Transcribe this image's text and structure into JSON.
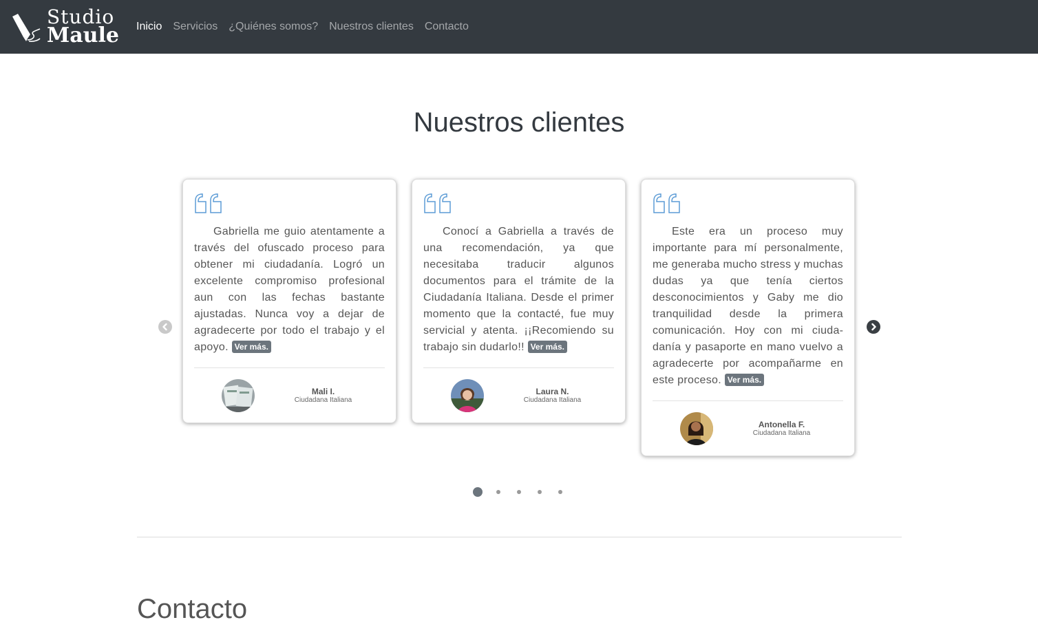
{
  "brand": {
    "line1": "Studio",
    "line2": "Maule"
  },
  "nav": {
    "items": [
      {
        "label": "Inicio",
        "active": true
      },
      {
        "label": "Servicios",
        "active": false
      },
      {
        "label": "¿Quiénes somos?",
        "active": false
      },
      {
        "label": "Nuestros clientes",
        "active": false
      },
      {
        "label": "Contacto",
        "active": false
      }
    ]
  },
  "clients": {
    "title": "Nuestros clientes",
    "testimonials": [
      {
        "text": "Gabriella me guio atentamente a través del ofuscado proceso para obte­ner mi ciudadanía. Logró un excelente compromiso profesional aun con las fechas bastante ajustadas. Nunca voy a dejar de agradecerte por todo el tra­bajo y el apoyo.",
        "more": "Ver más.",
        "name": "Mali I.",
        "role": "Ciudadana Italiana"
      },
      {
        "text": "Conocí a Gabriella a través de una recomendación, ya que necesitaba tra­ducir algunos documentos para el trá­mite de la Ciudadanía Italiana. Desde el primer momento que la contacté, fue muy servicial y atenta. ¡¡Recomiendo su trabajo sin dudarlo!!",
        "more": "Ver más.",
        "name": "Laura N.",
        "role": "Ciudadana Italiana"
      },
      {
        "text": "Este era un proceso muy importan­te para mí personalmente, me genera­ba mucho stress y muchas dudas ya que tenía ciertos desconocimientos y Gaby me dio tranquilidad desde la pri­mera comunicación. Hoy con mi ciuda­danía y pasaporte en mano vuelvo a agradecerte por acompañarme en este proceso.",
        "more": "Ver más.",
        "name": "Antonella F.",
        "role": "Ciudadana Italiana"
      }
    ],
    "indicators": {
      "count": 5,
      "active": 0
    }
  },
  "contact": {
    "title": "Contacto"
  },
  "colors": {
    "navbar": "#343a40",
    "accent_quote": "#5b9bd5",
    "badge": "#6c757d"
  }
}
